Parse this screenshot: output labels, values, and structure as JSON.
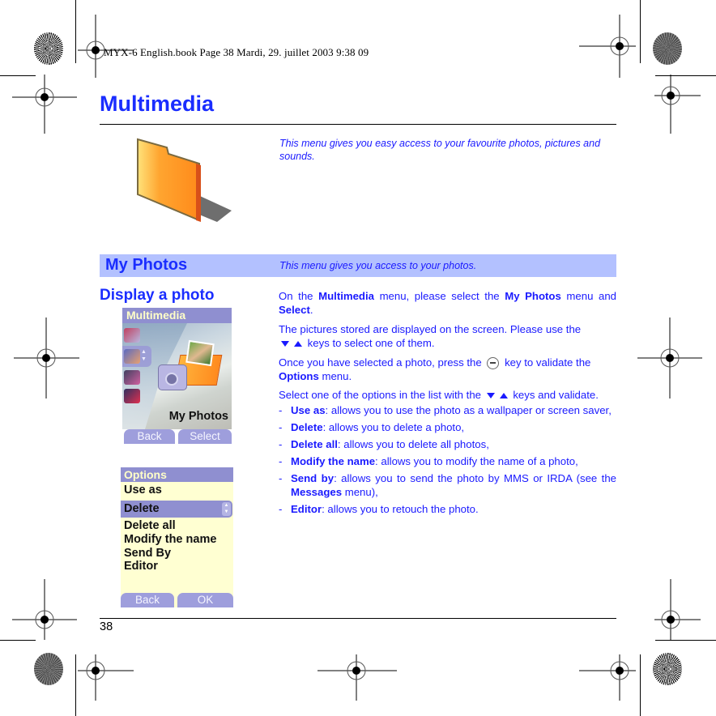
{
  "print_header": "MYX-6 English.book  Page 38  Mardi, 29. juillet 2003  9:38 09",
  "page_title": "Multimedia",
  "intro": "This menu gives you easy access to your favourite photos, pictures and sounds.",
  "section": {
    "title": "My Photos",
    "description": "This menu gives you access to your photos."
  },
  "subsection_title": "Display a photo",
  "paragraphs": {
    "p1": {
      "t1": "On the ",
      "b1": "Multimedia",
      "t2": " menu, please select the ",
      "b2": "My Photos",
      "t3": " menu and ",
      "b3": "Select",
      "t4": "."
    },
    "p2": {
      "t1": "The pictures stored are displayed on the screen. Please use the",
      "t2": "keys to select one of them."
    },
    "p3": {
      "t1": "Once you have selected a photo, press the",
      "t2": "key to validate the ",
      "b1": "Options",
      "t3": " menu."
    },
    "p4": {
      "t1": "Select one of the options in the list with the",
      "t2": "keys and validate."
    }
  },
  "options_list": [
    {
      "term": "Use as",
      "desc": ": allows you to use the photo as a wallpaper or screen saver,"
    },
    {
      "term": "Delete",
      "desc": ": allows you to delete a photo,"
    },
    {
      "term": "Delete all",
      "desc": ": allows you to delete all photos,"
    },
    {
      "term": "Modify the name",
      "desc": ": allows you to modify the name of a photo,"
    },
    {
      "term": "Send by",
      "desc": ": allows you to send the photo by MMS or IRDA (see the ",
      "term2": "Messages",
      "desc2": " menu),"
    },
    {
      "term": "Editor",
      "desc": ": allows you to retouch the photo."
    }
  ],
  "dash": "-",
  "phone_screen_1": {
    "header": "Multimedia",
    "selected_label": "My Photos",
    "softkey_left": "Back",
    "softkey_right": "Select",
    "side_icons": [
      "photo-stack-icon",
      "photos-icon",
      "pictures-icon",
      "sounds-icon"
    ]
  },
  "phone_screen_2": {
    "header": "Options",
    "items": [
      "Use as",
      "Delete",
      "Delete all",
      "Modify the name",
      "Send By",
      "Editor"
    ],
    "selected_index": 1,
    "softkey_left": "Back",
    "softkey_right": "OK"
  },
  "page_number": "38",
  "colors": {
    "heading_blue": "#1a2dff",
    "text_blue": "#1a1aff",
    "section_bar": "#b3c1ff",
    "phone_header": "#8f8fd0",
    "phone_options_bg": "#ffffd2"
  }
}
